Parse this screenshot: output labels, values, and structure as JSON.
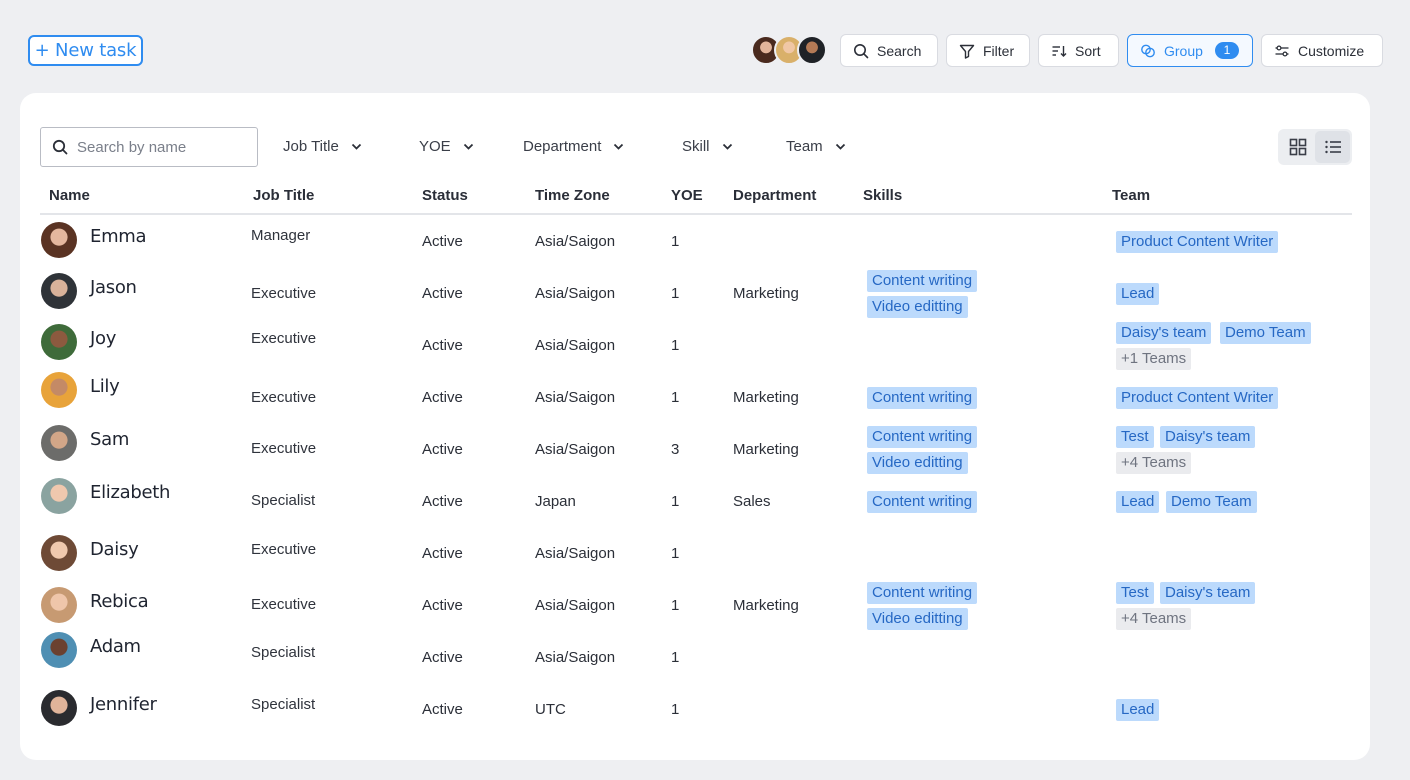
{
  "toolbar": {
    "new_task_label": "+ New task",
    "search_label": "Search",
    "filter_label": "Filter",
    "sort_label": "Sort",
    "group_label": "Group",
    "group_count": "1",
    "customize_label": "Customize"
  },
  "filters": {
    "search_placeholder": "Search by name",
    "dropdowns": [
      "Job Title",
      "YOE",
      "Department",
      "Skill",
      "Team"
    ]
  },
  "table": {
    "headers": [
      "Name",
      "Job Title",
      "Status",
      "Time Zone",
      "YOE",
      "Department",
      "Skills",
      "Team"
    ],
    "rows": [
      {
        "name": "Emma",
        "job_title": "Manager",
        "status": "Active",
        "time_zone": "Asia/Saigon",
        "yoe": "1",
        "department": "",
        "skills": [],
        "teams": [
          "Product Content Writer"
        ],
        "more_teams": ""
      },
      {
        "name": "Jason",
        "job_title": "Executive",
        "status": "Active",
        "time_zone": "Asia/Saigon",
        "yoe": "1",
        "department": "Marketing",
        "skills": [
          "Content writing",
          "Video editting"
        ],
        "teams": [
          "Lead"
        ],
        "more_teams": ""
      },
      {
        "name": "Joy",
        "job_title": "Executive",
        "status": "Active",
        "time_zone": "Asia/Saigon",
        "yoe": "1",
        "department": "",
        "skills": [],
        "teams": [
          "Daisy's team",
          "Demo Team"
        ],
        "more_teams": "+1 Teams"
      },
      {
        "name": "Lily",
        "job_title": "Executive",
        "status": "Active",
        "time_zone": "Asia/Saigon",
        "yoe": "1",
        "department": "Marketing",
        "skills": [
          "Content writing"
        ],
        "teams": [
          "Product Content Writer"
        ],
        "more_teams": ""
      },
      {
        "name": "Sam",
        "job_title": "Executive",
        "status": "Active",
        "time_zone": "Asia/Saigon",
        "yoe": "3",
        "department": "Marketing",
        "skills": [
          "Content writing",
          "Video editting"
        ],
        "teams": [
          "Test",
          "Daisy's team"
        ],
        "more_teams": "+4 Teams"
      },
      {
        "name": "Elizabeth",
        "job_title": "Specialist",
        "status": "Active",
        "time_zone": "Japan",
        "yoe": "1",
        "department": "Sales",
        "skills": [
          "Content writing"
        ],
        "teams": [
          "Lead",
          "Demo Team"
        ],
        "more_teams": ""
      },
      {
        "name": "Daisy",
        "job_title": "Executive",
        "status": "Active",
        "time_zone": "Asia/Saigon",
        "yoe": "1",
        "department": "",
        "skills": [],
        "teams": [],
        "more_teams": ""
      },
      {
        "name": "Rebica",
        "job_title": "Executive",
        "status": "Active",
        "time_zone": "Asia/Saigon",
        "yoe": "1",
        "department": "Marketing",
        "skills": [
          "Content writing",
          "Video editting"
        ],
        "teams": [
          "Test",
          "Daisy's team"
        ],
        "more_teams": "+4 Teams"
      },
      {
        "name": "Adam",
        "job_title": "Specialist",
        "status": "Active",
        "time_zone": "Asia/Saigon",
        "yoe": "1",
        "department": "",
        "skills": [],
        "teams": [],
        "more_teams": ""
      },
      {
        "name": "Jennifer",
        "job_title": "Specialist",
        "status": "Active",
        "time_zone": "UTC",
        "yoe": "1",
        "department": "",
        "skills": [],
        "teams": [
          "Lead"
        ],
        "more_teams": ""
      }
    ]
  },
  "colors": {
    "accent": "#2f8cf0",
    "chip_bg": "#bcdafc",
    "chip_text": "#2668c4",
    "more_chip_bg": "#eaebee",
    "page_bg": "#eeeff2"
  }
}
